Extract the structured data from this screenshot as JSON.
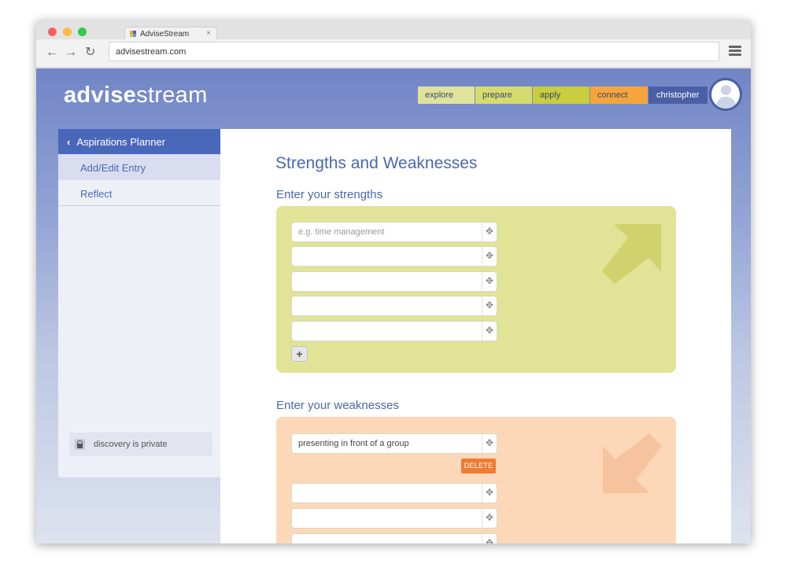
{
  "browser": {
    "tab_title": "AdviseStream",
    "tab_close": "×",
    "url": "advisestream.com",
    "back_glyph": "←",
    "forward_glyph": "→",
    "reload_glyph": "↻"
  },
  "header": {
    "logo_bold": "advise",
    "logo_light": "stream",
    "nav": [
      {
        "label": "explore",
        "color": "#dfe39c"
      },
      {
        "label": "prepare",
        "color": "#d6db6d"
      },
      {
        "label": "apply",
        "color": "#c9cd3e"
      },
      {
        "label": "connect",
        "color": "#f6a53c"
      }
    ],
    "user": "christopher"
  },
  "sidebar": {
    "title": "Aspirations Planner",
    "back_glyph": "‹",
    "items": [
      "Add/Edit Entry",
      "Reflect"
    ],
    "privacy": "discovery is private"
  },
  "main": {
    "title": "Strengths and Weaknesses",
    "strengths": {
      "label": "Enter your strengths",
      "placeholder": "e.g. time management",
      "entries": [
        "",
        "",
        "",
        "",
        ""
      ],
      "add_label": "+"
    },
    "weaknesses": {
      "label": "Enter your weaknesses",
      "entries": [
        "presenting in front of a group",
        "",
        "",
        ""
      ],
      "delete_label": "DELETE"
    },
    "drag_glyph": "✥"
  }
}
